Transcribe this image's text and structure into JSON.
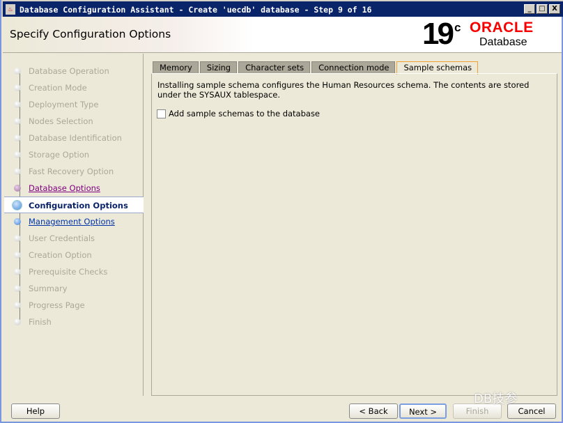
{
  "window": {
    "title": "Database Configuration Assistant - Create 'uecdb' database - Step 9 of 16",
    "minimize": "_",
    "maximize": "□",
    "close": "X"
  },
  "header": {
    "title": "Specify Configuration Options",
    "logo": {
      "version": "19",
      "suffix": "c",
      "brand": "ORACLE",
      "product": "Database"
    }
  },
  "steps": [
    {
      "label": "Database Operation",
      "state": "pending"
    },
    {
      "label": "Creation Mode",
      "state": "pending"
    },
    {
      "label": "Deployment Type",
      "state": "pending"
    },
    {
      "label": "Nodes Selection",
      "state": "pending"
    },
    {
      "label": "Database Identification",
      "state": "pending"
    },
    {
      "label": "Storage Option",
      "state": "pending"
    },
    {
      "label": "Fast Recovery Option",
      "state": "pending"
    },
    {
      "label": "Database Options",
      "state": "done"
    },
    {
      "label": "Configuration Options",
      "state": "cur"
    },
    {
      "label": "Management Options",
      "state": "next"
    },
    {
      "label": "User Credentials",
      "state": "pending"
    },
    {
      "label": "Creation Option",
      "state": "pending"
    },
    {
      "label": "Prerequisite Checks",
      "state": "pending"
    },
    {
      "label": "Summary",
      "state": "pending"
    },
    {
      "label": "Progress Page",
      "state": "pending"
    },
    {
      "label": "Finish",
      "state": "pending"
    }
  ],
  "tabs": [
    {
      "label": "Memory"
    },
    {
      "label": "Sizing"
    },
    {
      "label": "Character sets"
    },
    {
      "label": "Connection mode"
    },
    {
      "label": "Sample schemas",
      "active": true
    }
  ],
  "content": {
    "description": "Installing sample schema configures the Human Resources schema. The contents are stored under the SYSAUX tablespace.",
    "checkbox_label": "Add sample schemas to the database",
    "checkbox_checked": false
  },
  "buttons": {
    "help": "Help",
    "back": "< Back",
    "next": "Next >",
    "finish": "Finish",
    "cancel": "Cancel"
  },
  "watermark": "DB技参"
}
